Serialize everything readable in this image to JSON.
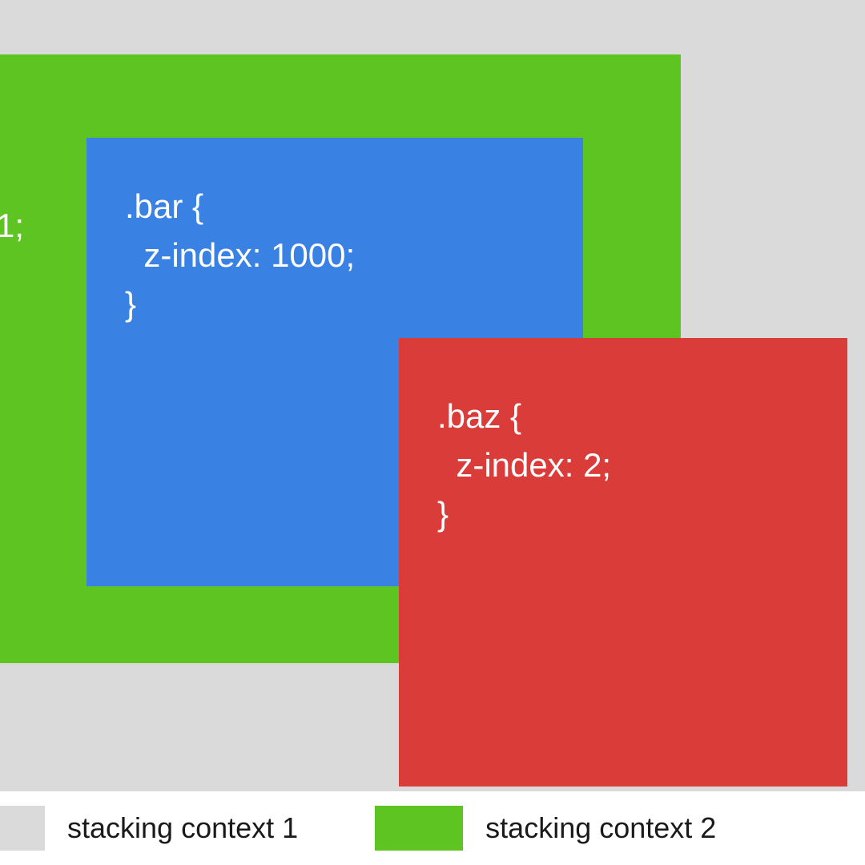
{
  "colors": {
    "background": "#dadada",
    "green": "#5ec421",
    "blue": "#3982e4",
    "red": "#d93c39",
    "white": "#ffffff"
  },
  "boxes": {
    "green": {
      "fragment": "1;"
    },
    "blue": {
      "code": ".bar {\n  z-index: 1000;\n}"
    },
    "red": {
      "code": ".baz {\n  z-index: 2;\n}"
    }
  },
  "legend": {
    "items": [
      {
        "label": "stacking context 1",
        "color": "#dadada"
      },
      {
        "label": "stacking context 2",
        "color": "#5ec421"
      }
    ]
  }
}
